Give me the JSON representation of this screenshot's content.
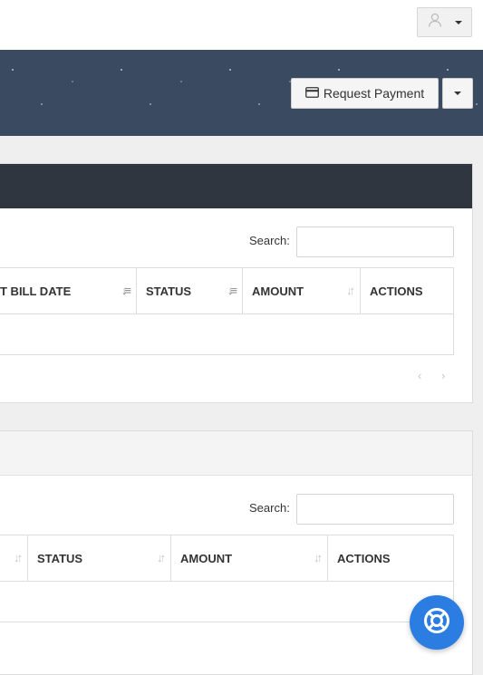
{
  "header": {
    "user_icon": "user-icon",
    "request_payment_label": "Request Payment",
    "request_payment_icon": "credit-card-icon"
  },
  "panel1": {
    "search_label": "Search:",
    "search_value": "",
    "columns": [
      "T BILL DATE",
      "STATUS",
      "AMOUNT",
      "ACTIONS"
    ],
    "pager_prev": "‹",
    "pager_next": "›"
  },
  "panel2": {
    "search_label": "Search:",
    "search_value": "",
    "columns": [
      "",
      "STATUS",
      "AMOUNT",
      "ACTIONS"
    ]
  },
  "help_button": {
    "icon": "lifebuoy-icon"
  },
  "colors": {
    "banner": "#3a4a60",
    "panel_header_dark": "#2f3640",
    "help_button": "#2b7de2"
  }
}
